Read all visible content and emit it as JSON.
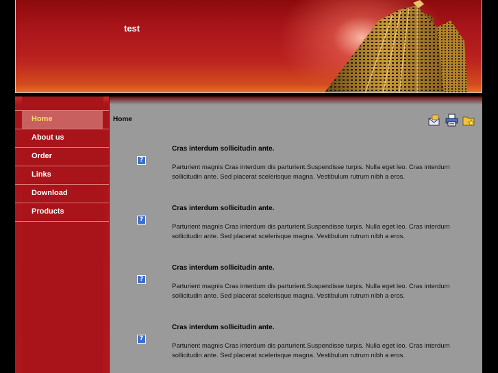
{
  "site": {
    "title": "test"
  },
  "nav": {
    "items": [
      {
        "label": "Home",
        "active": true
      },
      {
        "label": "About us"
      },
      {
        "label": "Order"
      },
      {
        "label": "Links"
      },
      {
        "label": "Download"
      },
      {
        "label": "Products"
      }
    ]
  },
  "breadcrumb": "Home",
  "toolbar": {
    "icons": [
      "email-icon",
      "print-icon",
      "bookmark-folder-icon"
    ]
  },
  "articles": [
    {
      "title": "Cras interdum sollicitudin ante.",
      "thumb": "?",
      "body": "Parturient magnis Cras interdum dis parturient.Suspendisse turpis. Nulla eget leo. Cras interdum sollicitudin ante. Sed placerat scelerisque magna. Vestibulum rutrum nibh a eros."
    },
    {
      "title": "Cras interdum sollicitudin ante.",
      "thumb": "?",
      "body": "Parturient magnis Cras interdum dis parturient.Suspendisse turpis. Nulla eget leo. Cras interdum sollicitudin ante. Sed placerat scelerisque magna. Vestibulum rutrum nibh a eros."
    },
    {
      "title": "Cras interdum sollicitudin ante.",
      "thumb": "?",
      "body": "Parturient magnis Cras interdum dis parturient.Suspendisse turpis. Nulla eget leo. Cras interdum sollicitudin ante. Sed placerat scelerisque magna. Vestibulum rutrum nibh a eros."
    },
    {
      "title": "Cras interdum sollicitudin ante.",
      "thumb": "?",
      "body": "Parturient magnis Cras interdum dis parturient.Suspendisse turpis. Nulla eget leo. Cras interdum sollicitudin ante. Sed placerat scelerisque magna. Vestibulum rutrum nibh a eros."
    }
  ],
  "colors": {
    "header_red": "#a8151a",
    "sidebar_red": "#a8141a",
    "content_gray": "#9a9a9a",
    "active_nav_text": "#ffdd66"
  }
}
